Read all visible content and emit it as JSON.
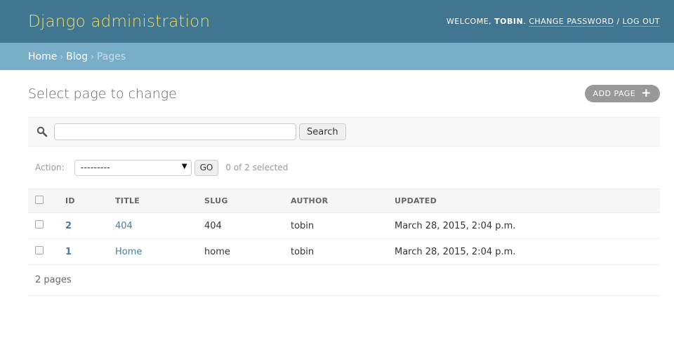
{
  "header": {
    "site_name": "Django administration",
    "welcome": "WELCOME,",
    "username": "TOBIN",
    "period": ".",
    "change_password": "CHANGE PASSWORD",
    "slash": "/",
    "log_out": "LOG OUT"
  },
  "breadcrumbs": {
    "items": [
      "Home",
      "Blog"
    ],
    "separator": "›",
    "current": "Pages"
  },
  "page": {
    "title": "Select page to change",
    "add_label": "ADD PAGE",
    "add_icon": "+"
  },
  "search": {
    "value": "",
    "placeholder": "",
    "button_label": "Search"
  },
  "actions": {
    "label": "Action:",
    "selected_option": "---------",
    "go_label": "GO",
    "selected_count": "0 of 2 selected"
  },
  "table": {
    "columns": [
      "ID",
      "TITLE",
      "SLUG",
      "AUTHOR",
      "UPDATED"
    ],
    "rows": [
      {
        "id": "2",
        "title": "404",
        "slug": "404",
        "author": "tobin",
        "updated": "March 28, 2015, 2:04 p.m."
      },
      {
        "id": "1",
        "title": "Home",
        "slug": "home",
        "author": "tobin",
        "updated": "March 28, 2015, 2:04 p.m."
      }
    ]
  },
  "paginator": {
    "text": "2 pages"
  },
  "colors": {
    "header_bg": "#417690",
    "site_name": "#f5dd5d",
    "breadcrumbs_bg": "#79aec8",
    "link": "#447e9b",
    "add_button_bg": "#999999"
  }
}
